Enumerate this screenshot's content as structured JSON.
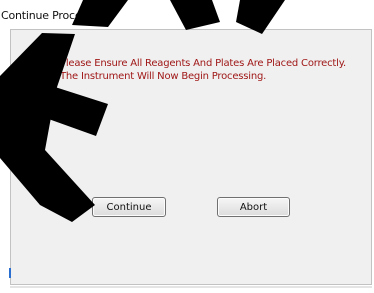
{
  "window": {
    "title": "Continue Processing"
  },
  "dialog": {
    "message": "Please Ensure All Reagents And Plates Are Placed Correctly. The Instrument Will Now Begin Processing.",
    "buttons": {
      "continue_label": "Continue",
      "abort_label": "Abort"
    }
  },
  "overlay": {
    "watermark_text": "A",
    "watermark_color": "#000000"
  },
  "colors": {
    "message_text": "#a01818",
    "panel_bg": "#f0f0f0"
  }
}
